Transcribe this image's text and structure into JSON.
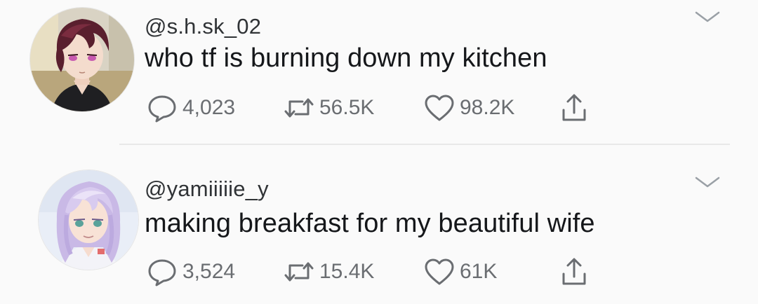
{
  "tweets": [
    {
      "handle": "@s.h.sk_02",
      "text": "who tf is burning down my kitchen",
      "replies": "4,023",
      "retweets": "56.5K",
      "likes": "98.2K",
      "avatar": "avatar-maroon-hair-man"
    },
    {
      "handle": "@yamiiiiie_y",
      "text": "making breakfast for my beautiful wife",
      "replies": "3,524",
      "retweets": "15.4K",
      "likes": "61K",
      "avatar": "avatar-lavender-hair-woman"
    }
  ],
  "icons": {
    "reply": "speech-bubble-icon",
    "retweet": "retweet-icon",
    "like": "heart-icon",
    "share": "share-icon",
    "menu": "chevron-down-icon"
  },
  "colors": {
    "background": "#fafafa",
    "text": "#15171a",
    "muted": "#6a6d71",
    "divider": "#e8e8e8"
  }
}
